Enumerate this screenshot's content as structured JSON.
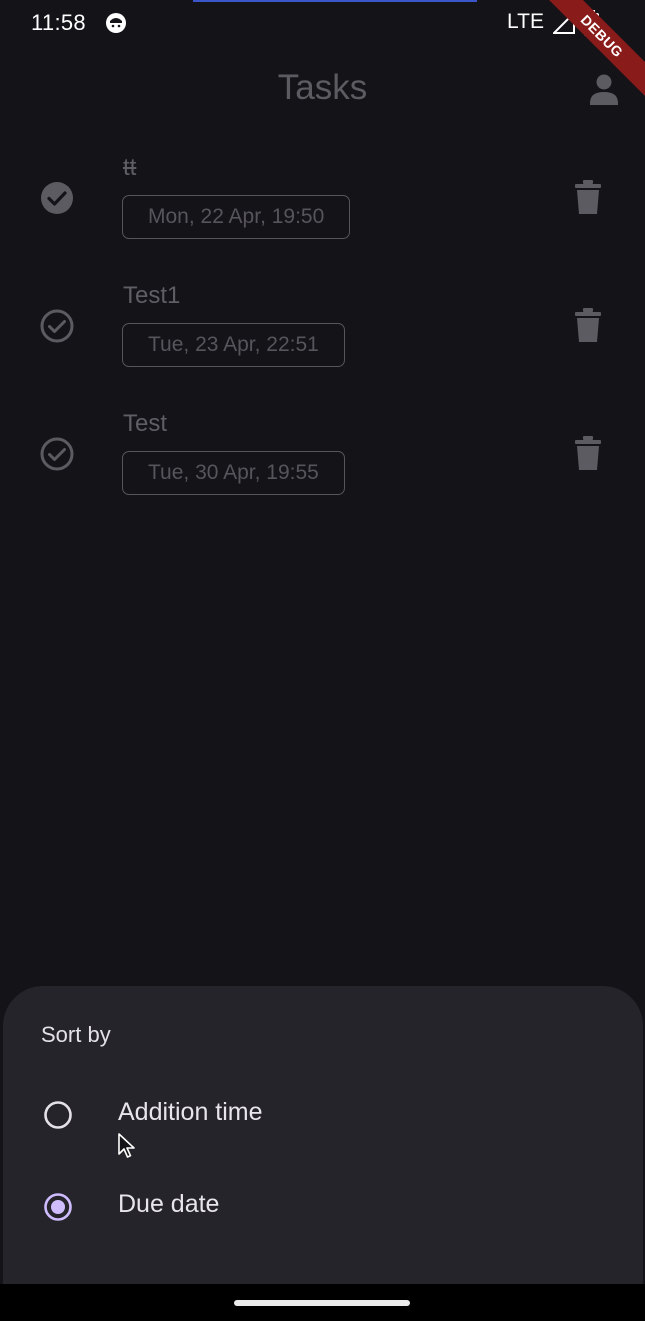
{
  "status_bar": {
    "time": "11:58",
    "network": "LTE",
    "debug_label": "DEBUG"
  },
  "app_bar": {
    "title": "Tasks"
  },
  "tasks": [
    {
      "title": "tt",
      "due": "Mon, 22 Apr, 19:50",
      "completed": true
    },
    {
      "title": "Test1",
      "due": "Tue, 23 Apr, 22:51",
      "completed": false
    },
    {
      "title": "Test",
      "due": "Tue, 30 Apr, 19:55",
      "completed": false
    }
  ],
  "sort_sheet": {
    "title": "Sort by",
    "options": [
      {
        "label": "Addition time",
        "selected": false
      },
      {
        "label": "Due date",
        "selected": true
      }
    ]
  },
  "colors": {
    "background": "#141318",
    "sheet": "#25242a",
    "accent": "#cfbcff",
    "muted": "#5c5b61",
    "debug_banner": "#8a1b1b"
  }
}
